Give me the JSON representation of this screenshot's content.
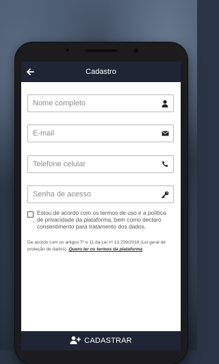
{
  "appbar": {
    "title": "Cadastro"
  },
  "form": {
    "name": {
      "placeholder": "Nome completo",
      "icon": "user-icon"
    },
    "email": {
      "placeholder": "E-mail",
      "icon": "envelope-icon"
    },
    "phone": {
      "placeholder": "Telefone celular",
      "icon": "phone-icon"
    },
    "password": {
      "placeholder": "Senha de acesso",
      "icon": "key-icon"
    }
  },
  "terms": {
    "checked": false,
    "text": "Estou de acordo com os termos de uso e a política de privacidade da plataforma, bem como declaro consentimento para tratamento dos dados."
  },
  "law": {
    "text": "De acordo com os artigos 7º e 11 da Lei nº 13.709/2018 (Lei geral de proteção de dados).",
    "link": "Quero ler os termos da plataforma"
  },
  "submit": {
    "label": "CADASTRAR",
    "icon": "add-user-icon"
  },
  "colors": {
    "appbar": "#1f2535",
    "background": "#ffffff"
  }
}
